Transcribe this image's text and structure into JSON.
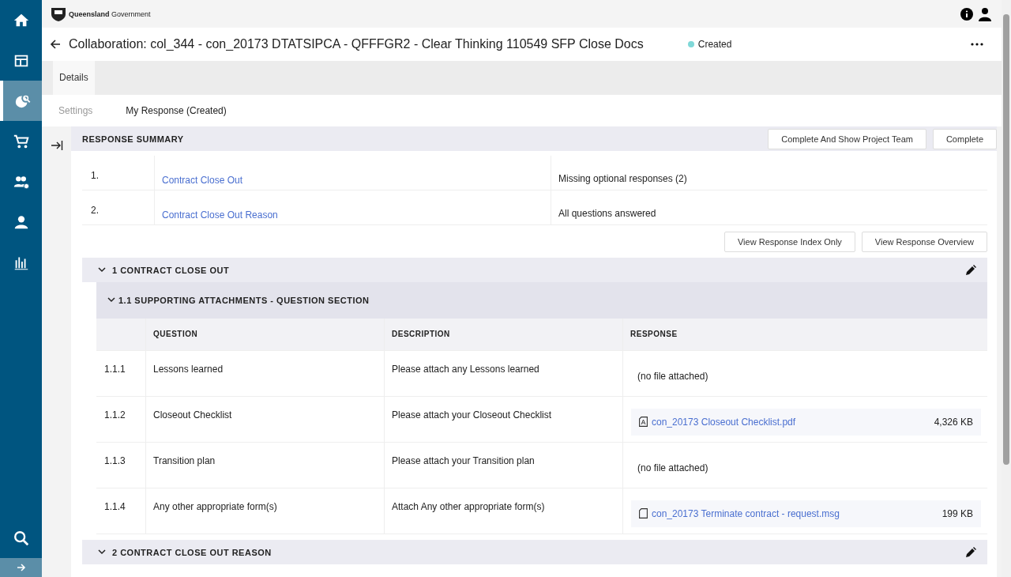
{
  "header": {
    "brand": "**Queensland** Government"
  },
  "title": "Collaboration: col_344 - con_20173 DTATSIPCA - QFFFGR2 - Clear Thinking 110549 SFP Close Docs",
  "status": {
    "label": "Created",
    "color": "#7fd8d8"
  },
  "sidebar": {
    "items": [
      {
        "kind": "home",
        "selected": false
      },
      {
        "kind": "layout",
        "selected": false
      },
      {
        "kind": "globe",
        "selected": true
      },
      {
        "kind": "cart",
        "selected": false
      },
      {
        "kind": "team",
        "selected": false
      },
      {
        "kind": "person",
        "selected": false
      },
      {
        "kind": "chart",
        "selected": false
      }
    ]
  },
  "tabs": [
    {
      "label": "Details",
      "selected": true
    }
  ],
  "subtabs": [
    {
      "label": "Settings",
      "selected": false
    },
    {
      "label": "My Response (Created)",
      "selected": true
    }
  ],
  "summary": {
    "title": "RESPONSE SUMMARY",
    "buttons": [
      "Complete And Show Project Team",
      "Complete"
    ],
    "rows": [
      {
        "number": "1.",
        "link": "Contract Close Out",
        "status": "Missing optional responses (2)"
      },
      {
        "number": "2.",
        "link": "Contract Close Out Reason",
        "status": "All questions answered"
      }
    ],
    "view_buttons": [
      "View Response Index Only",
      "View Response Overview"
    ]
  },
  "sections": [
    {
      "title": "1 CONTRACT CLOSE OUT",
      "expanded": true,
      "subsections": [
        {
          "title": "1.1 SUPPORTING ATTACHMENTS - QUESTION SECTION",
          "expanded": true,
          "columns": [
            "QUESTION",
            "DESCRIPTION",
            "RESPONSE"
          ],
          "rows": [
            {
              "number": "1.1.1",
              "question": "Lessons learned",
              "description": "Please attach any Lessons learned",
              "response": {
                "kind": "none",
                "text": "(no file attached)"
              }
            },
            {
              "number": "1.1.2",
              "question": "Closeout Checklist",
              "description": "Please attach your Closeout Checklist",
              "response": {
                "kind": "pdf",
                "text": "con_20173 Closeout Checklist.pdf",
                "size": "4,326 KB"
              }
            },
            {
              "number": "1.1.3",
              "question": "Transition plan",
              "description": "Please attach your Transition plan",
              "response": {
                "kind": "none",
                "text": "(no file attached)"
              }
            },
            {
              "number": "1.1.4",
              "question": "Any other appropriate form(s)",
              "description": "Attach Any other appropriate form(s)",
              "response": {
                "kind": "file",
                "text": "con_20173 Terminate contract - request.msg",
                "size": "199 KB"
              }
            }
          ]
        }
      ]
    },
    {
      "title": "2 CONTRACT CLOSE OUT REASON",
      "expanded": true
    }
  ]
}
